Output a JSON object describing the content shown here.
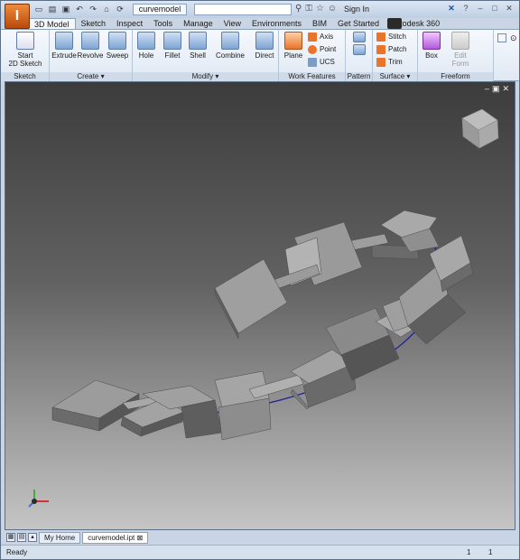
{
  "titlebar": {
    "doc_name": "curvemodel",
    "sign_in": "Sign In",
    "app_icon": "I"
  },
  "tabs": [
    "3D Model",
    "Sketch",
    "Inspect",
    "Tools",
    "Manage",
    "View",
    "Environments",
    "BIM",
    "Get Started",
    "Autodesk 360"
  ],
  "ribbon": {
    "sketch": {
      "label": "Sketch",
      "start_sketch": "Start\n2D Sketch"
    },
    "create": {
      "label": "Create",
      "extrude": "Extrude",
      "revolve": "Revolve",
      "sweep": "Sweep"
    },
    "modify": {
      "label": "Modify",
      "hole": "Hole",
      "fillet": "Fillet",
      "shell": "Shell",
      "combine": "Combine",
      "direct": "Direct"
    },
    "work_features": {
      "label": "Work Features",
      "plane": "Plane",
      "axis": "Axis",
      "point": "Point",
      "ucs": "UCS"
    },
    "pattern": {
      "label": "Pattern"
    },
    "surface": {
      "label": "Surface",
      "stitch": "Stitch",
      "patch": "Patch",
      "trim": "Trim"
    },
    "freeform": {
      "label": "Freeform",
      "box": "Box",
      "edit_form": "Edit\nForm"
    }
  },
  "doc_tabs": {
    "home": "My Home",
    "file": "curvemodel.ipt"
  },
  "status": {
    "text": "Ready",
    "n1": "1",
    "n2": "1"
  },
  "colors": {
    "accent": "#e9742a",
    "curve": "#1c1c9c"
  }
}
